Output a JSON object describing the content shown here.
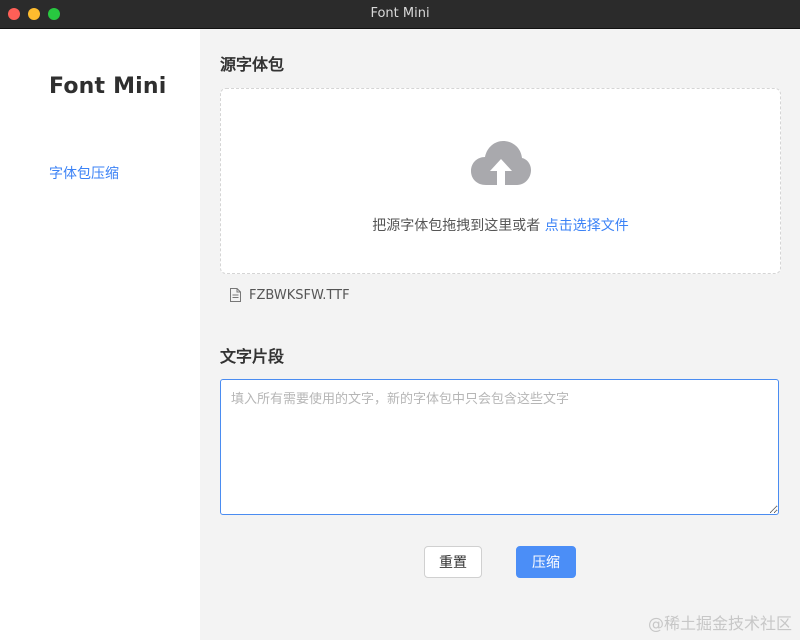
{
  "window": {
    "title": "Font Mini"
  },
  "sidebar": {
    "app_name": "Font Mini",
    "items": [
      {
        "label": "字体包压缩",
        "active": true
      }
    ]
  },
  "source_section": {
    "title": "源字体包",
    "dropzone_text": "把源字体包拖拽到这里或者",
    "dropzone_link": "点击选择文件",
    "file_name": "FZBWKSFW.TTF"
  },
  "text_section": {
    "title": "文字片段",
    "placeholder": "填入所有需要使用的文字，新的字体包中只会包含这些文字",
    "value": ""
  },
  "buttons": {
    "reset": "重置",
    "compress": "压缩"
  },
  "watermark": "@稀土掘金技术社区",
  "colors": {
    "accent": "#3b82f6",
    "primary_button": "#4b8ef7",
    "titlebar": "#2b2b2b"
  },
  "icons": {
    "upload": "cloud-upload-icon",
    "file": "document-icon"
  }
}
